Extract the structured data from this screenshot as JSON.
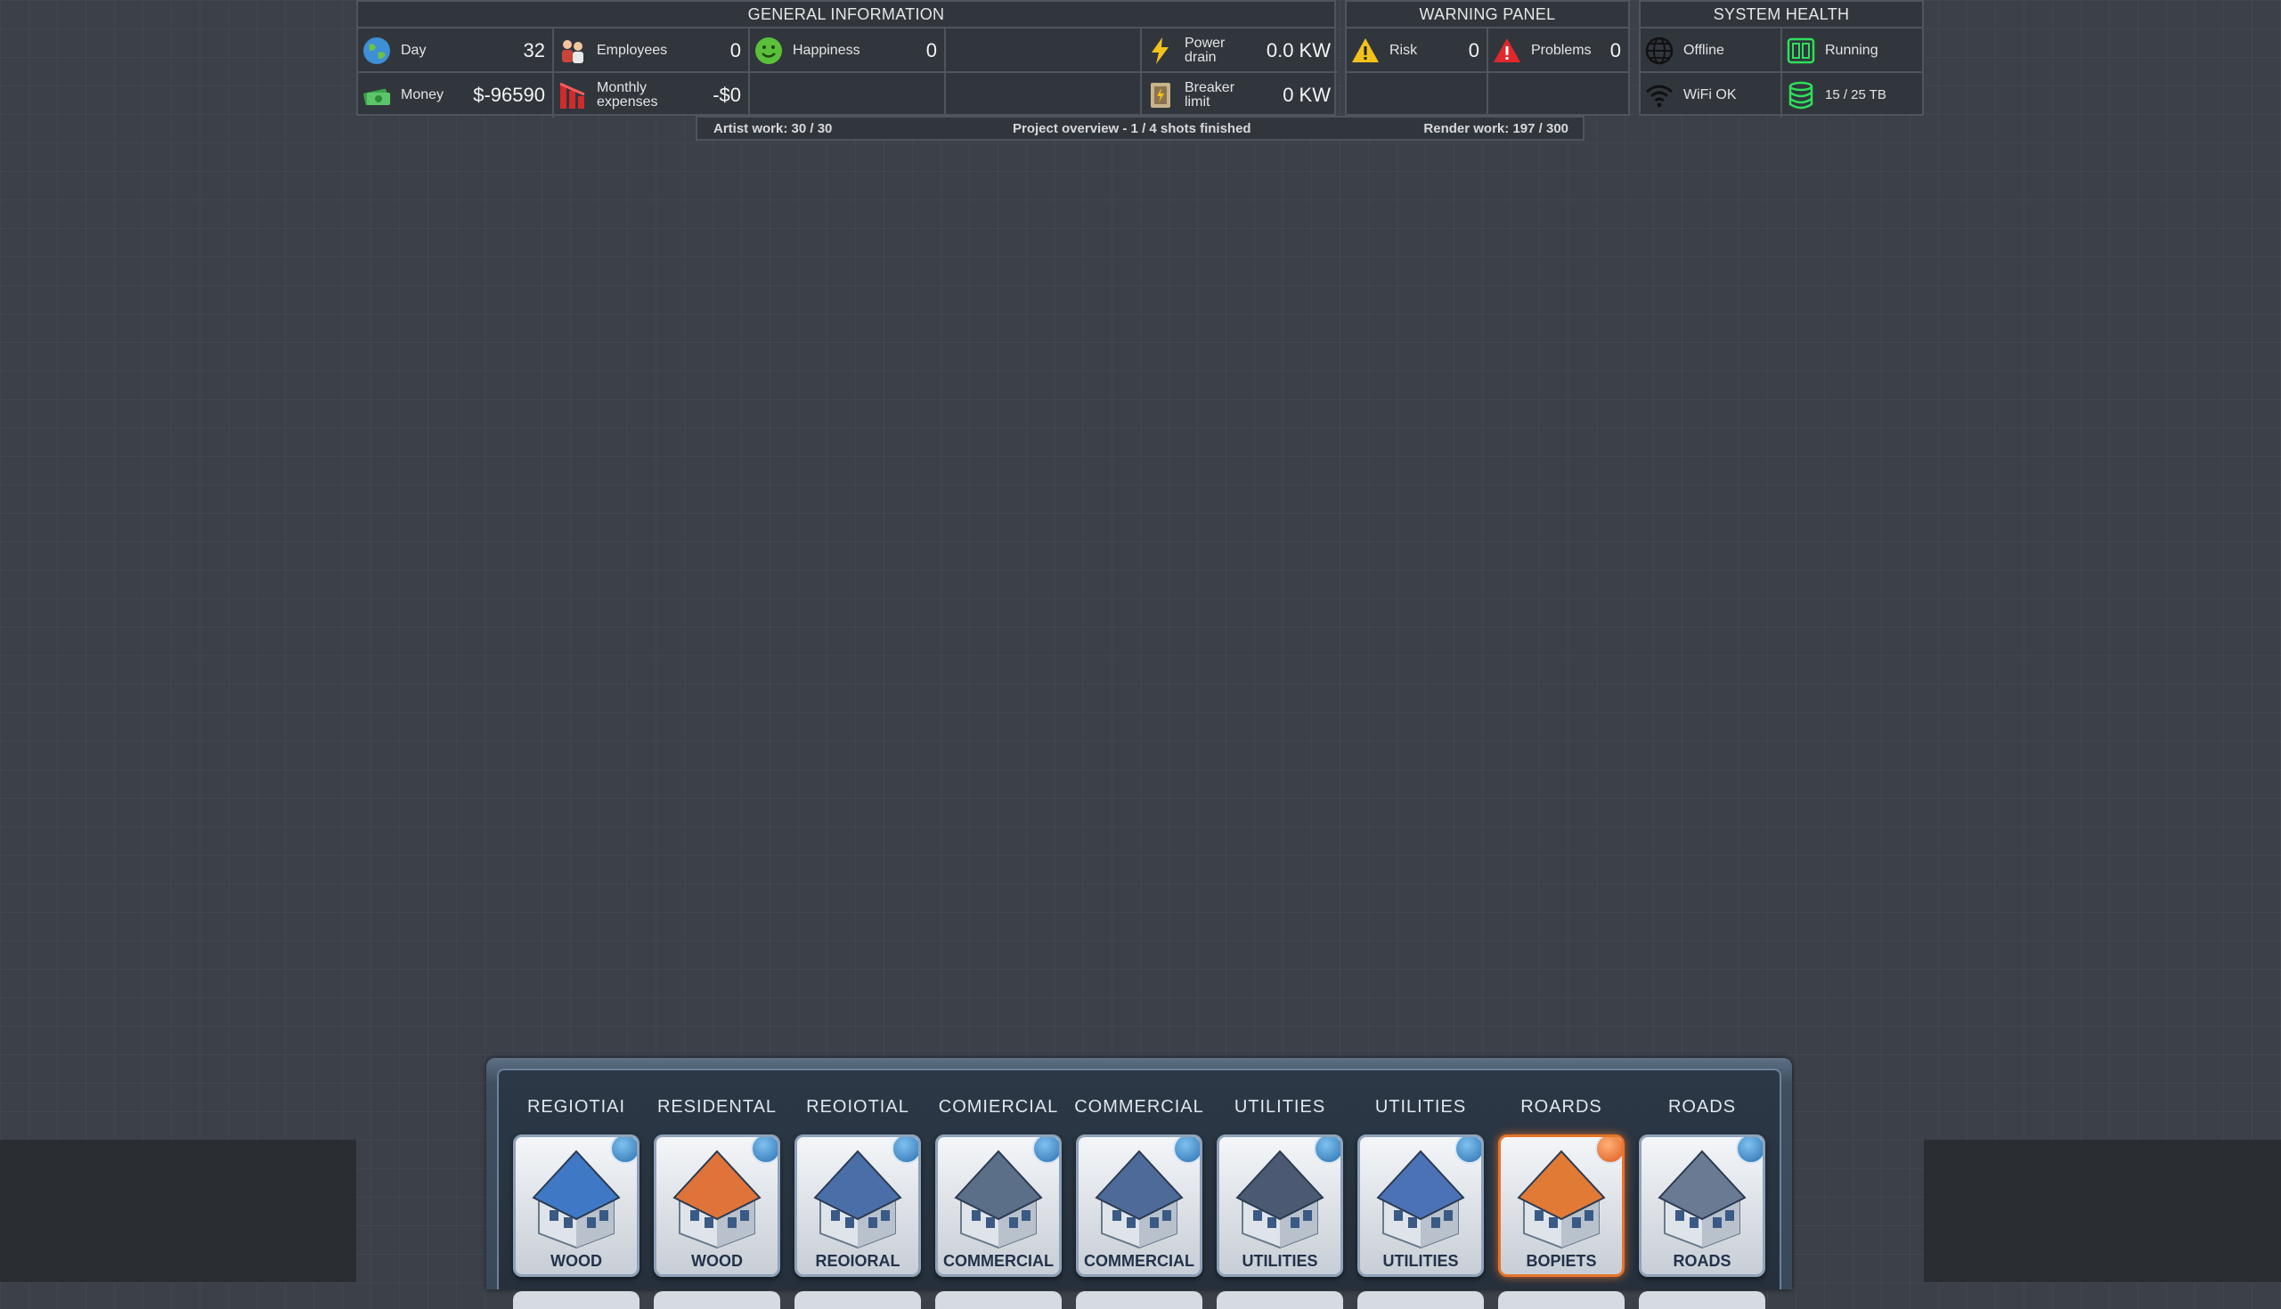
{
  "general": {
    "title": "GENERAL INFORMATION",
    "day": {
      "label": "Day",
      "value": "32"
    },
    "employees": {
      "label": "Employees",
      "value": "0"
    },
    "happiness": {
      "label": "Happiness",
      "value": "0"
    },
    "power": {
      "label1": "Power",
      "label2": "drain",
      "value": "0.0 KW"
    },
    "money": {
      "label": "Money",
      "value": "$-96590"
    },
    "expenses": {
      "label1": "Monthly",
      "label2": "expenses",
      "value": "-$0"
    },
    "breaker": {
      "label1": "Breaker",
      "label2": "limit",
      "value": "0 KW"
    }
  },
  "warning": {
    "title": "WARNING PANEL",
    "risk": {
      "label": "Risk",
      "value": "0"
    },
    "problems": {
      "label": "Problems",
      "value": "0"
    }
  },
  "system": {
    "title": "SYSTEM HEALTH",
    "network": {
      "label": "Offline"
    },
    "status": {
      "label": "Running"
    },
    "wifi": {
      "label": "WiFi OK"
    },
    "storage": {
      "label": "15 / 25 TB"
    }
  },
  "progress": {
    "artist": "Artist work: 30 / 30",
    "project": "Project overview - 1 / 4 shots finished",
    "render": "Render work: 197 / 300"
  },
  "build_menu": {
    "tabs": [
      "REGIOTIAI",
      "RESIDENTAL",
      "REOIOTIAL",
      "COMIERCIAL",
      "COMMERCIAL",
      "UTILITIES",
      "UTILITIES",
      "ROARDS",
      "ROADS"
    ],
    "cards": [
      {
        "caption": "WOOD",
        "roof": "#3f78c4",
        "highlighted": false
      },
      {
        "caption": "WOOD",
        "roof": "#e0733a",
        "highlighted": false
      },
      {
        "caption": "REOIORAL",
        "roof": "#4a6fa8",
        "highlighted": false
      },
      {
        "caption": "COMMERCIAL",
        "roof": "#5b6f88",
        "highlighted": false
      },
      {
        "caption": "COMMERCIAL",
        "roof": "#4d6a99",
        "highlighted": false
      },
      {
        "caption": "UTILITIES",
        "roof": "#4b5a72",
        "highlighted": false
      },
      {
        "caption": "UTILITIES",
        "roof": "#4a72b5",
        "highlighted": false
      },
      {
        "caption": "BOPIETS",
        "roof": "#e07a35",
        "highlighted": true
      },
      {
        "caption": "ROADS",
        "roof": "#6a7a92",
        "highlighted": false
      }
    ]
  },
  "colors": {
    "background": "#3b4049",
    "panel": "#31363d",
    "border": "#4f555d",
    "accent_orange": "#e8732a",
    "badge_blue": "#2a6fb0"
  },
  "icons": {
    "day": "globe-icon",
    "employees": "people-icon",
    "happiness": "smiley-icon",
    "power": "lightning-icon",
    "money": "cash-icon",
    "expenses": "expense-chart-icon",
    "breaker": "breaker-icon",
    "risk": "warning-triangle-icon",
    "problems": "alert-triangle-icon",
    "network": "globe-grid-icon",
    "status": "server-icon",
    "wifi": "wifi-icon",
    "storage": "database-icon"
  }
}
